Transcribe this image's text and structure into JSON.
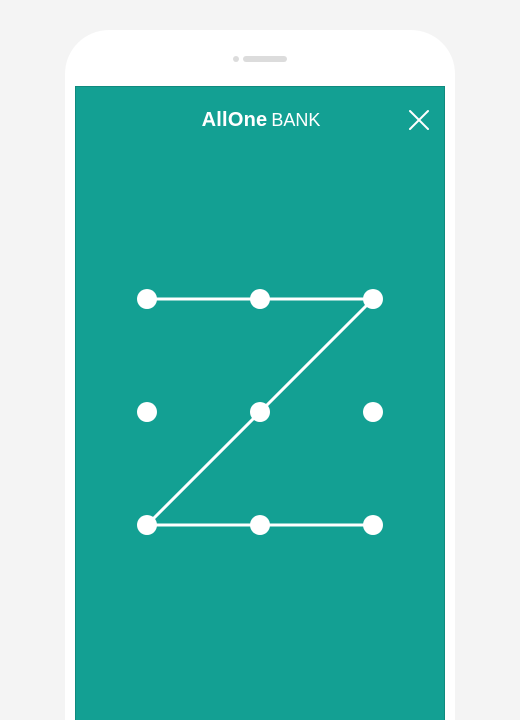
{
  "header": {
    "logo_text": "AllOne",
    "bank_text": "BANK",
    "close_icon": "close-icon"
  },
  "pattern_lock": {
    "grid": {
      "rows": 3,
      "cols": 3
    },
    "dots": [
      {
        "row": 0,
        "col": 0
      },
      {
        "row": 0,
        "col": 1
      },
      {
        "row": 0,
        "col": 2
      },
      {
        "row": 1,
        "col": 0
      },
      {
        "row": 1,
        "col": 1
      },
      {
        "row": 1,
        "col": 2
      },
      {
        "row": 2,
        "col": 0
      },
      {
        "row": 2,
        "col": 1
      },
      {
        "row": 2,
        "col": 2
      }
    ],
    "drawn_sequence": [
      0,
      1,
      2,
      4,
      6,
      7,
      8
    ]
  },
  "colors": {
    "screen_background": "#13a093",
    "page_background": "#f4f4f4",
    "device_body": "#ffffff",
    "pattern_color": "#ffffff"
  }
}
